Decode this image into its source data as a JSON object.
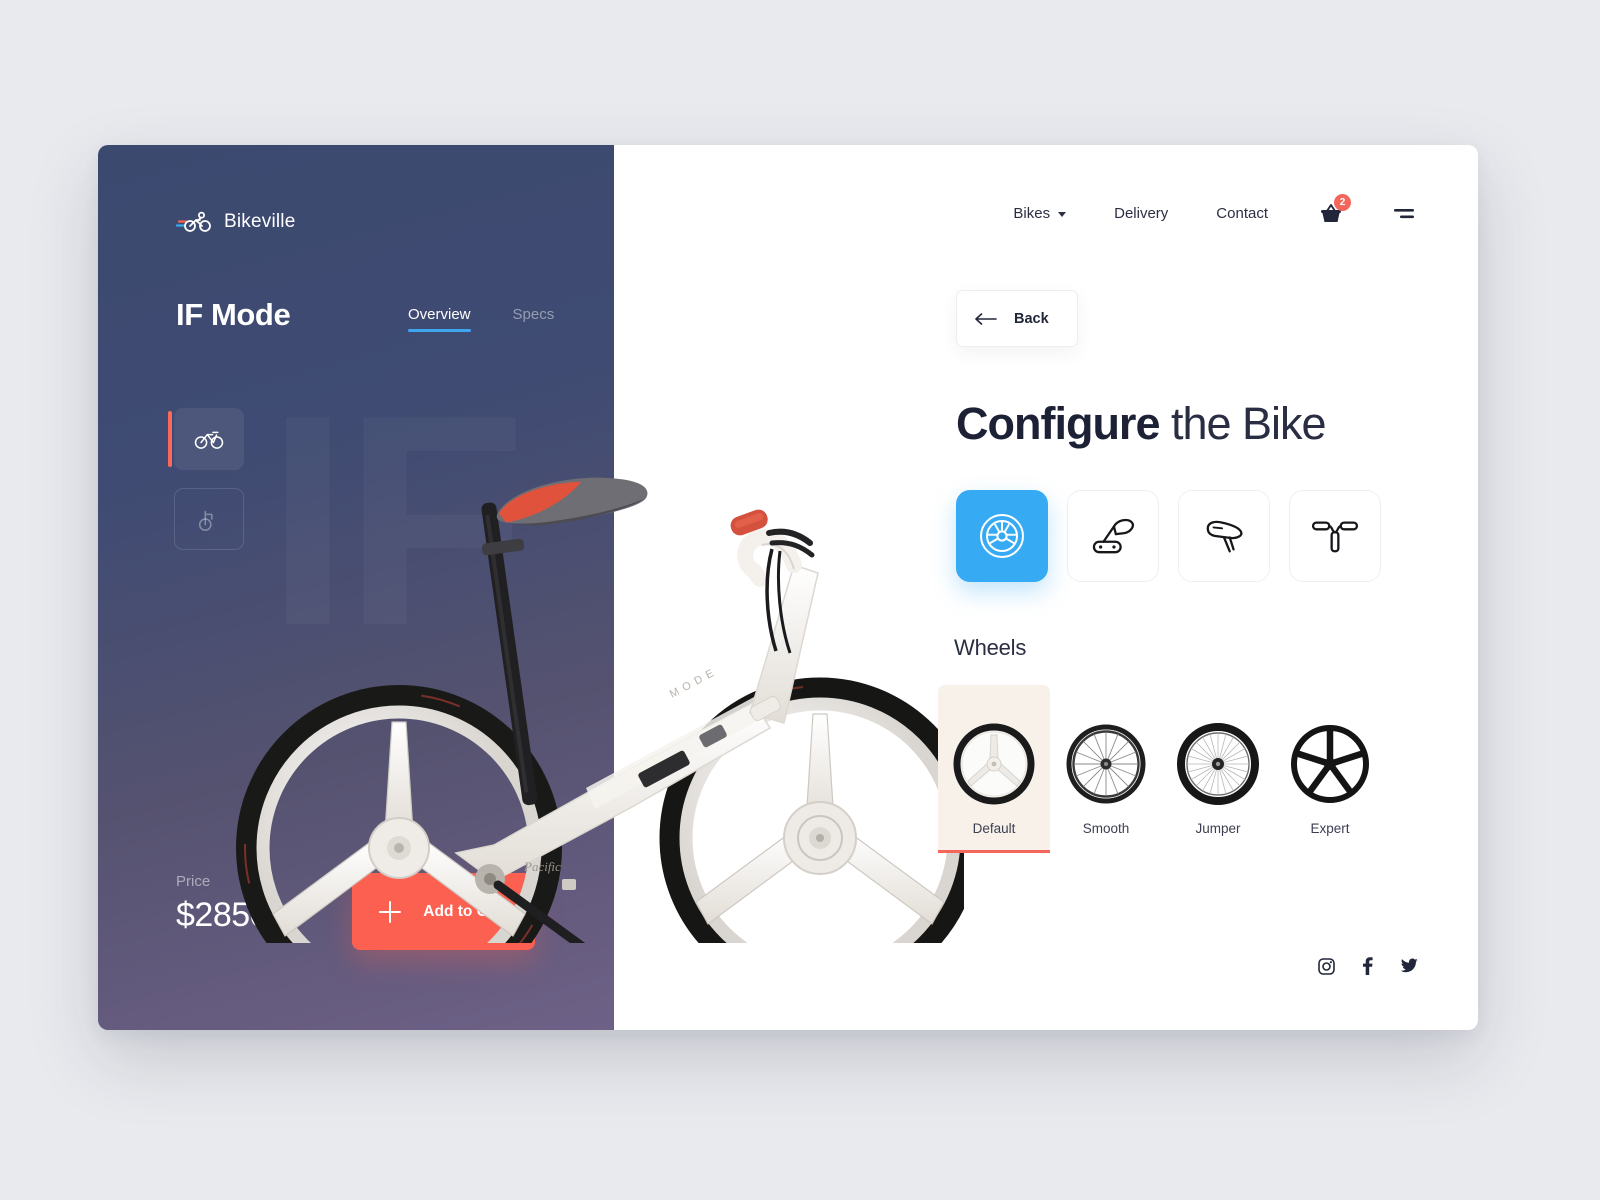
{
  "left_panel": {
    "brand": {
      "name": "Bikeville",
      "logo_icon": "cyclist-icon"
    },
    "watermark": "IF",
    "product_title": "IF Mode",
    "tabs": [
      {
        "label": "Overview",
        "active": true
      },
      {
        "label": "Specs",
        "active": false
      }
    ],
    "view_toggles": [
      {
        "icon": "bicycle-icon",
        "active": true
      },
      {
        "icon": "folded-bicycle-icon",
        "active": false
      }
    ],
    "price": {
      "label": "Price",
      "value": "$2850"
    },
    "cart_button": {
      "label": "Add to Cart",
      "icon": "plus-icon"
    },
    "accent_red": "#fb6051",
    "accent_blue": "#3ea5ef"
  },
  "header": {
    "nav": [
      {
        "label": "Bikes",
        "has_chevron": true
      },
      {
        "label": "Delivery",
        "has_chevron": false
      },
      {
        "label": "Contact",
        "has_chevron": false
      }
    ],
    "cart": {
      "icon": "basket-icon",
      "badge": "2",
      "badge_color": "#f4665c"
    },
    "menu": {
      "icon": "menu-icon"
    }
  },
  "main": {
    "back_button": {
      "label": "Back",
      "icon": "arrow-left-icon"
    },
    "heading_bold": "Configure",
    "heading_light": " the Bike",
    "categories": [
      {
        "name": "wheel-icon",
        "active": true
      },
      {
        "name": "pedal-icon",
        "active": false
      },
      {
        "name": "saddle-icon",
        "active": false
      },
      {
        "name": "handlebar-icon",
        "active": false
      }
    ],
    "section_title": "Wheels",
    "wheel_options": [
      {
        "label": "Default",
        "selected": true,
        "style": "three-spoke"
      },
      {
        "label": "Smooth",
        "selected": false,
        "style": "thin-spokes"
      },
      {
        "label": "Jumper",
        "selected": false,
        "style": "dense-spokes"
      },
      {
        "label": "Expert",
        "selected": false,
        "style": "five-spoke"
      }
    ],
    "selected_color": "#f7f1ea",
    "active_category_color": "#36aaf3"
  },
  "footer": {
    "socials": [
      {
        "name": "instagram-icon"
      },
      {
        "name": "facebook-icon"
      },
      {
        "name": "twitter-icon"
      }
    ]
  }
}
